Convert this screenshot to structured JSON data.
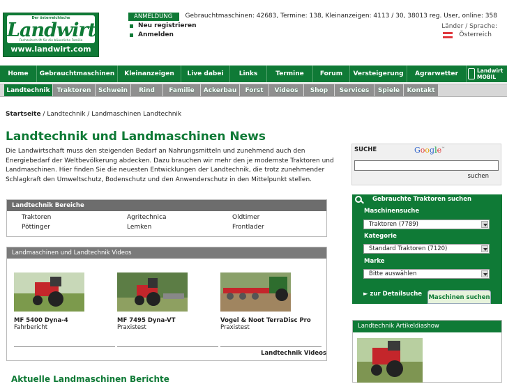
{
  "logo": {
    "tagline": "Der österreichische",
    "brand": "Landwirt",
    "subtitle": "Fachzeitschrift für die bäuerliche Familie",
    "url": "www.landwirt.com"
  },
  "header": {
    "anmeldung": "ANMELDUNG",
    "register": "Neu registrieren",
    "login": "Anmelden",
    "stats": "Gebrauchtmaschinen: 42683, Termine: 138, Kleinanzeigen: 4113 / 30, 38013 reg. User, online: 358",
    "lang_label": "Länder / Sprache:",
    "country": "Österreich"
  },
  "nav_main": [
    "Home",
    "Gebrauchtmaschinen",
    "Kleinanzeigen",
    "Live dabei",
    "Links",
    "Termine",
    "Forum",
    "Versteigerung",
    "Agrarwetter"
  ],
  "nav_mobile": [
    "Landwirt",
    "MOBIL"
  ],
  "nav_sub": [
    "Landtechnik",
    "Traktoren",
    "Schwein",
    "Rind",
    "Familie",
    "Ackerbau",
    "Forst",
    "Videos",
    "Shop",
    "Services",
    "Spiele",
    "Kontakt"
  ],
  "breadcrumb": {
    "home": "Startseite",
    "sep1": " / ",
    "level1": "Landtechnik",
    "sep2": " / ",
    "level2": "Landmaschinen Landtechnik"
  },
  "page_title": "Landtechnik und Landmaschinen News",
  "intro": "Die Landwirtschaft muss den steigenden Bedarf an Nahrungsmitteln und zunehmend auch den Energiebedarf der Weltbevölkerung abdecken. Dazu brauchen wir mehr den je modernste Traktoren und Landmaschinen. Hier finden Sie die neuesten Entwicklungen der Landtechnik, die trotz zunehmender Schlagkraft den Umweltschutz, Bodenschutz und den Anwenderschutz in den Mittelpunkt stellen.",
  "bereiche": {
    "title": "Landtechnik Bereiche",
    "items": [
      "Traktoren",
      "Agritechnica",
      "Oldtimer",
      "Pöttinger",
      "Lemken",
      "Frontlader"
    ]
  },
  "videos": {
    "title": "Landmaschinen und Landtechnik Videos",
    "items": [
      {
        "title": "MF 5400 Dyna-4",
        "sub": "Fahrbericht"
      },
      {
        "title": "MF 7495 Dyna-VT",
        "sub": "Praxistest"
      },
      {
        "title": "Vogel & Noot TerraDisc Pro",
        "sub": "Praxistest"
      }
    ],
    "more": "Landtechnik Videos"
  },
  "section2_title": "Aktuelle Landmaschinen Berichte",
  "search": {
    "label": "SUCHE",
    "google": [
      "G",
      "o",
      "o",
      "g",
      "l",
      "e"
    ],
    "tm": "™",
    "button": "suchen"
  },
  "tractor_search": {
    "title": "Gebrauchte Traktoren suchen",
    "maschinen_label": "Maschinensuche",
    "maschinen_value": "Traktoren (7789)",
    "kategorie_label": "Kategorie",
    "kategorie_value": "Standard Traktoren (7120)",
    "marke_label": "Marke",
    "marke_value": "Bitte auswählen",
    "detail": "► zur Detailsuche",
    "submit": "Maschinen suchen"
  },
  "diashow": {
    "title": "Landtechnik Artikeldiashow"
  },
  "colors": {
    "brand_green": "#0f7a36",
    "gray_header": "#6d6d6d"
  }
}
